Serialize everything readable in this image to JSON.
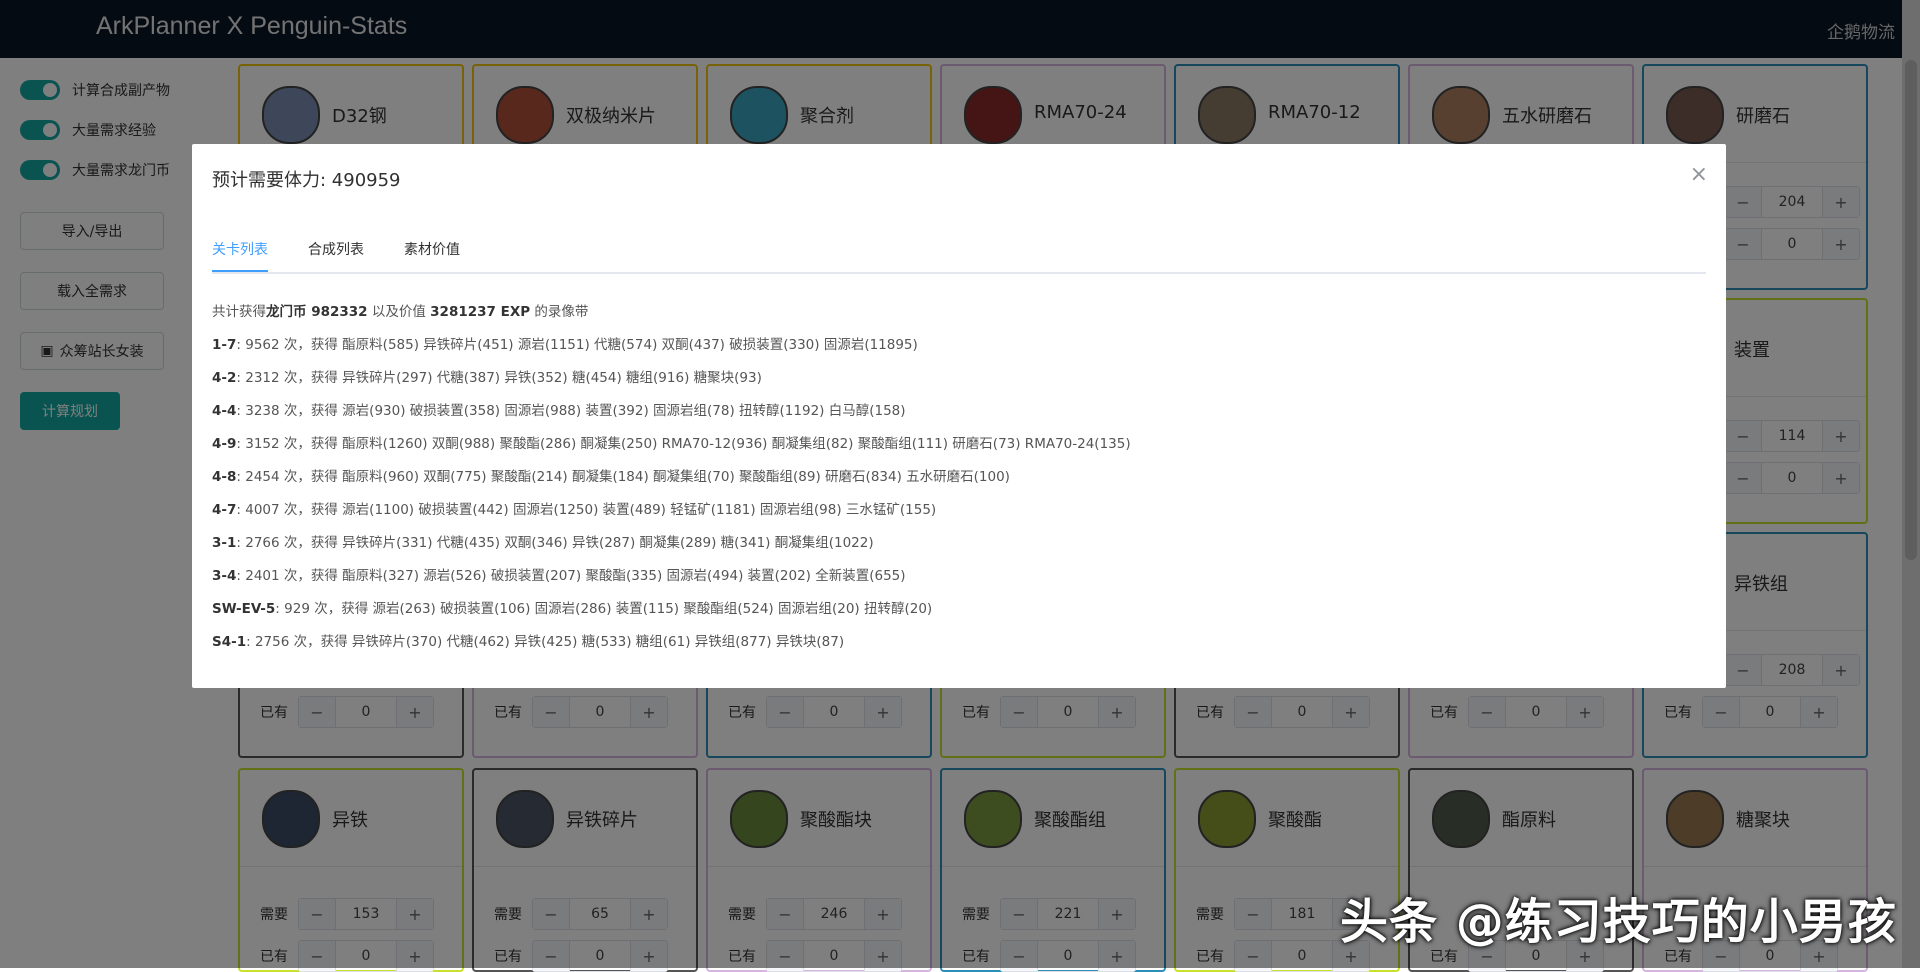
{
  "app": {
    "title": "ArkPlanner X Penguin-Stats",
    "right_link": "企鹅物流"
  },
  "sidebar": {
    "switches": [
      {
        "label": "计算合成副产物",
        "on": true
      },
      {
        "label": "大量需求经验",
        "on": true
      },
      {
        "label": "大量需求龙门币",
        "on": true
      }
    ],
    "buttons": {
      "import_export": "导入/导出",
      "load_all": "载入全需求",
      "crowd": "众筹站长女装",
      "compute": "计算规划"
    }
  },
  "cards": [
    {
      "name": "D32钢",
      "border": "#f1c40f",
      "icon_color": "#7a8fb3"
    },
    {
      "name": "双极纳米片",
      "border": "#f1c40f",
      "icon_color": "#b0503a"
    },
    {
      "name": "聚合剂",
      "border": "#f1c40f",
      "icon_color": "#3aa7c0"
    },
    {
      "name": "RMA70-24",
      "border": "#d6b5e0",
      "icon_color": "#8a2a2a"
    },
    {
      "name": "RMA70-12",
      "border": "#2c8fb8",
      "icon_color": "#8a7a62"
    },
    {
      "name": "五水研磨石",
      "border": "#d6b5e0",
      "icon_color": "#b08060"
    },
    {
      "name": "研磨石",
      "border": "#2c8fb8",
      "icon_color": "#7a5a50"
    }
  ],
  "right_col": [
    {
      "label": "装置",
      "need": "114",
      "have": "0"
    },
    {
      "label": "异铁组",
      "need": "208",
      "have": "0"
    }
  ],
  "row_b_values": {
    "need_first": "204",
    "have_first": "0"
  },
  "middle_row_have": {
    "label": "已有",
    "value": "0"
  },
  "bottom_cards": [
    {
      "name": "异铁",
      "border": "#c9e02c",
      "need": "153",
      "have": "0"
    },
    {
      "name": "异铁碎片",
      "border": "#555555",
      "need": "65",
      "have": "0"
    },
    {
      "name": "聚酸酯块",
      "border": "#d6b5e0",
      "need": "246",
      "have": "0"
    },
    {
      "name": "聚酸酯组",
      "border": "#2c8fb8",
      "need": "221",
      "have": "0"
    },
    {
      "name": "聚酸酯",
      "border": "#c9e02c",
      "need": "181",
      "have": "0"
    },
    {
      "name": "酯原料",
      "border": "#555555",
      "need": "",
      "have": "0"
    },
    {
      "name": "糖聚块",
      "border": "#d6b5e0",
      "need": "",
      "have": "0"
    }
  ],
  "labels": {
    "need": "需要",
    "have": "已有",
    "minus": "−",
    "plus": "+"
  },
  "modal": {
    "title": "预计需要体力: 490959",
    "tabs": [
      "关卡列表",
      "合成列表",
      "素材价值"
    ],
    "summary_pre": "共计获得",
    "summary_bold1": "龙门币 982332",
    "summary_mid": " 以及价值 ",
    "summary_bold2": "3281237 EXP",
    "summary_post": " 的录像带",
    "stages": [
      {
        "stage": "1-7",
        "times": ": 9562 次，获得 ",
        "drops": "酯原料(585) 异铁碎片(451) 源岩(1151) 代糖(574) 双酮(437) 破损装置(330) 固源岩(11895)"
      },
      {
        "stage": "4-2",
        "times": ": 2312 次，获得 ",
        "drops": "异铁碎片(297) 代糖(387) 异铁(352) 糖(454) 糖组(916) 糖聚块(93)"
      },
      {
        "stage": "4-4",
        "times": ": 3238 次，获得 ",
        "drops": "源岩(930) 破损装置(358) 固源岩(988) 装置(392) 固源岩组(78) 扭转醇(1192) 白马醇(158)"
      },
      {
        "stage": "4-9",
        "times": ": 3152 次，获得 ",
        "drops": "酯原料(1260) 双酮(988) 聚酸酯(286) 酮凝集(250) RMA70-12(936) 酮凝集组(82) 聚酸酯组(111) 研磨石(73) RMA70-24(135)"
      },
      {
        "stage": "4-8",
        "times": ": 2454 次，获得 ",
        "drops": "酯原料(960) 双酮(775) 聚酸酯(214) 酮凝集(184) 酮凝集组(70) 聚酸酯组(89) 研磨石(834) 五水研磨石(100)"
      },
      {
        "stage": "4-7",
        "times": ": 4007 次，获得 ",
        "drops": "源岩(1100) 破损装置(442) 固源岩(1250) 装置(489) 轻锰矿(1181) 固源岩组(98) 三水锰矿(155)"
      },
      {
        "stage": "3-1",
        "times": ": 2766 次，获得 ",
        "drops": "异铁碎片(331) 代糖(435) 双酮(346) 异铁(287) 酮凝集(289) 糖(341) 酮凝集组(1022)"
      },
      {
        "stage": "3-4",
        "times": ": 2401 次，获得 ",
        "drops": "酯原料(327) 源岩(526) 破损装置(207) 聚酸酯(335) 固源岩(494) 装置(202) 全新装置(655)"
      },
      {
        "stage": "SW-EV-5",
        "times": ": 929 次，获得 ",
        "drops": "源岩(263) 破损装置(106) 固源岩(286) 装置(115) 聚酸酯组(524) 固源岩组(20) 扭转醇(20)"
      },
      {
        "stage": "S4-1",
        "times": ": 2756 次，获得 ",
        "drops": "异铁碎片(370) 代糖(462) 异铁(425) 糖(533) 糖组(61) 异铁组(877) 异铁块(87)"
      }
    ],
    "close_glyph": "×"
  },
  "watermark": "头条 @练习技巧的小男孩"
}
